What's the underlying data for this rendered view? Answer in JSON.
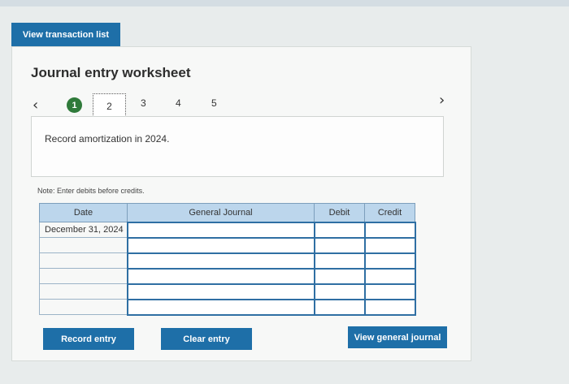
{
  "buttons": {
    "view_transaction_list": "View transaction list",
    "record_entry": "Record entry",
    "clear_entry": "Clear entry",
    "view_general_journal": "View general journal"
  },
  "worksheet": {
    "title": "Journal entry worksheet",
    "steps": [
      "1",
      "2",
      "3",
      "4",
      "5"
    ],
    "completed_step": "1",
    "current_step": "2",
    "instruction": "Record amortization in 2024.",
    "note": "Note: Enter debits before credits."
  },
  "table": {
    "headers": [
      "Date",
      "General Journal",
      "Debit",
      "Credit"
    ],
    "rows": [
      [
        "December 31, 2024",
        "",
        "",
        ""
      ],
      [
        "",
        "",
        "",
        ""
      ],
      [
        "",
        "",
        "",
        ""
      ],
      [
        "",
        "",
        "",
        ""
      ],
      [
        "",
        "",
        "",
        ""
      ],
      [
        "",
        "",
        "",
        ""
      ]
    ]
  },
  "colors": {
    "button_blue": "#1e6fa8",
    "header_blue": "#bcd6ec",
    "completed_green": "#2f7a3a"
  },
  "icons": {
    "prev": "chevron-left-icon",
    "next": "chevron-right-icon"
  }
}
